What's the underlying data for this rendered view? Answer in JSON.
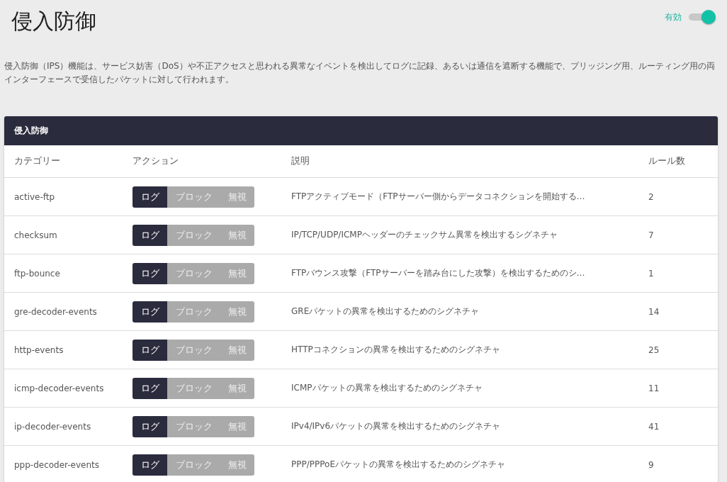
{
  "page": {
    "title": "侵入防御",
    "toggle": {
      "label": "有効",
      "on": true
    }
  },
  "description": "侵入防御（IPS）機能は、サービス妨害（DoS）や不正アクセスと思われる異常なイベントを検出してログに記録、あるいは通信を遮断する機能で、ブリッジング用、ルーティング用の両インターフェースで受信したパケットに対して行われます。",
  "card": {
    "title": "侵入防御",
    "columns": [
      "カテゴリー",
      "アクション",
      "説明",
      "ルール数"
    ],
    "rows": [
      {
        "category": "active-ftp",
        "actions": [
          {
            "label": "ログ",
            "selected": true
          },
          {
            "label": "ブロック",
            "selected": false
          },
          {
            "label": "無視",
            "selected": false
          }
        ],
        "description": "FTPアクティブモード（FTPサーバー側からデータコネクションを開始する…",
        "count": "2"
      },
      {
        "category": "checksum",
        "actions": [
          {
            "label": "ログ",
            "selected": true
          },
          {
            "label": "ブロック",
            "selected": false
          },
          {
            "label": "無視",
            "selected": false
          }
        ],
        "description": "IP/TCP/UDP/ICMPヘッダーのチェックサム異常を検出するシグネチャ",
        "count": "7"
      },
      {
        "category": "ftp-bounce",
        "actions": [
          {
            "label": "ログ",
            "selected": true
          },
          {
            "label": "ブロック",
            "selected": false
          },
          {
            "label": "無視",
            "selected": false
          }
        ],
        "description": "FTPバウンス攻撃（FTPサーバーを踏み台にした攻撃）を検出するためのシ…",
        "count": "1"
      },
      {
        "category": "gre-decoder-events",
        "actions": [
          {
            "label": "ログ",
            "selected": true
          },
          {
            "label": "ブロック",
            "selected": false
          },
          {
            "label": "無視",
            "selected": false
          }
        ],
        "description": "GREパケットの異常を検出するためのシグネチャ",
        "count": "14"
      },
      {
        "category": "http-events",
        "actions": [
          {
            "label": "ログ",
            "selected": true
          },
          {
            "label": "ブロック",
            "selected": false
          },
          {
            "label": "無視",
            "selected": false
          }
        ],
        "description": "HTTPコネクションの異常を検出するためのシグネチャ",
        "count": "25"
      },
      {
        "category": "icmp-decoder-events",
        "actions": [
          {
            "label": "ログ",
            "selected": true
          },
          {
            "label": "ブロック",
            "selected": false
          },
          {
            "label": "無視",
            "selected": false
          }
        ],
        "description": "ICMPパケットの異常を検出するためのシグネチャ",
        "count": "11"
      },
      {
        "category": "ip-decoder-events",
        "actions": [
          {
            "label": "ログ",
            "selected": true
          },
          {
            "label": "ブロック",
            "selected": false
          },
          {
            "label": "無視",
            "selected": false
          }
        ],
        "description": "IPv4/IPv6パケットの異常を検出するためのシグネチャ",
        "count": "41"
      },
      {
        "category": "ppp-decoder-events",
        "actions": [
          {
            "label": "ログ",
            "selected": true
          },
          {
            "label": "ブロック",
            "selected": false
          },
          {
            "label": "無視",
            "selected": false
          }
        ],
        "description": "PPP/PPPoEパケットの異常を検出するためのシグネチャ",
        "count": "9"
      }
    ]
  }
}
